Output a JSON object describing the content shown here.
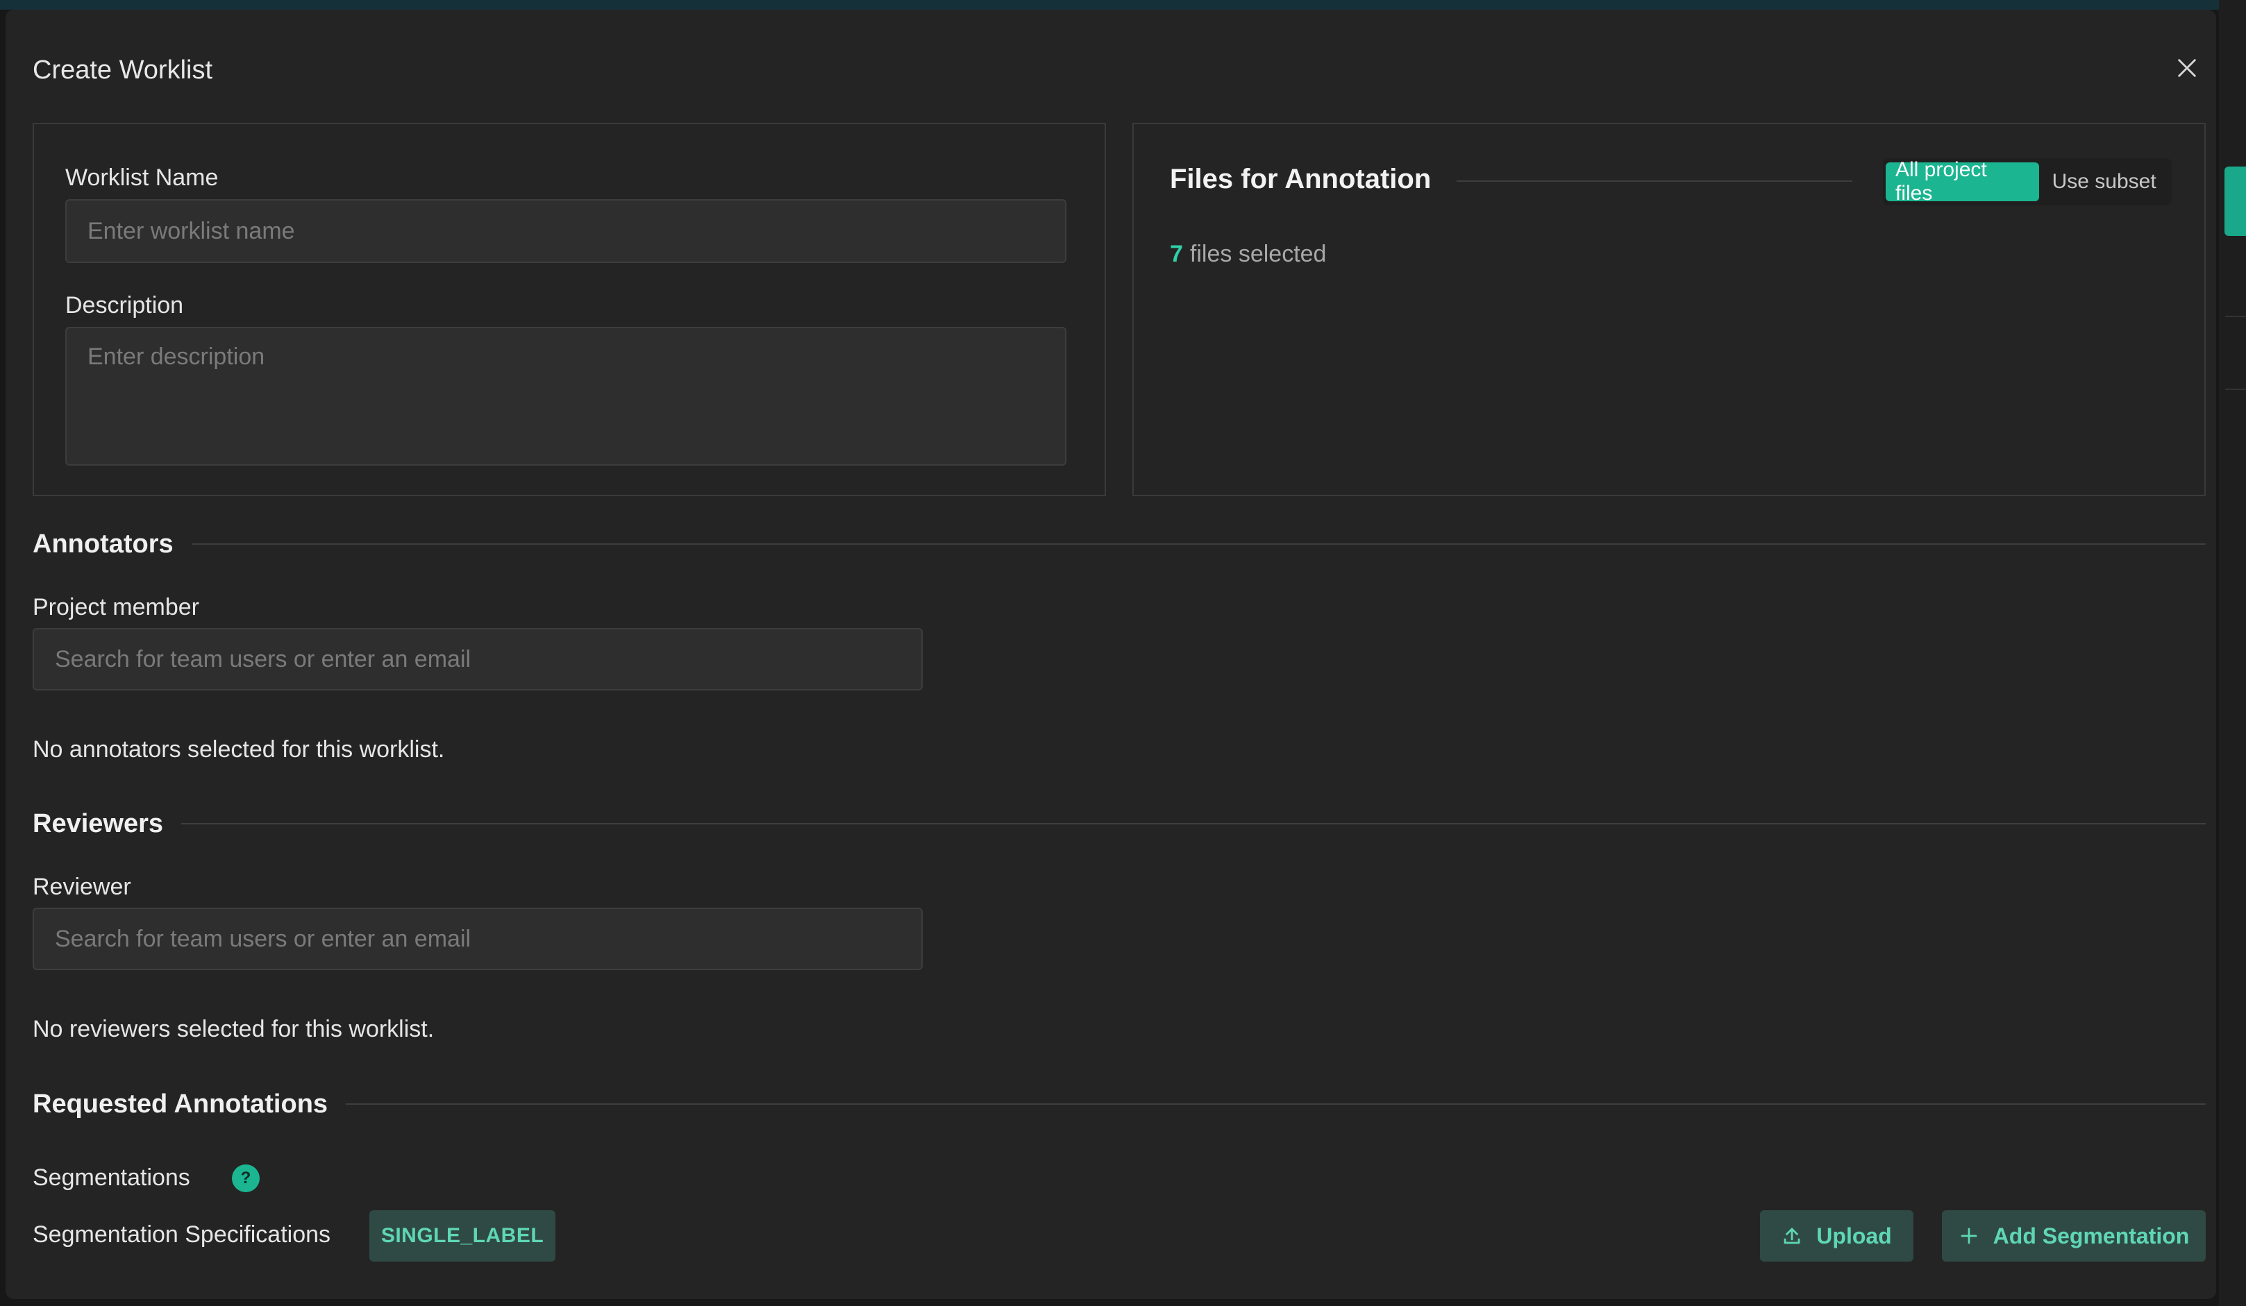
{
  "modal": {
    "title": "Create Worklist",
    "close_icon": "close-icon"
  },
  "form": {
    "name_label": "Worklist Name",
    "name_placeholder": "Enter worklist name",
    "name_value": "",
    "description_label": "Description",
    "description_placeholder": "Enter description",
    "description_value": ""
  },
  "files": {
    "title": "Files for Annotation",
    "toggle": [
      {
        "label": "All project files",
        "active": true
      },
      {
        "label": "Use subset",
        "active": false
      }
    ],
    "count": "7",
    "count_suffix": "files selected"
  },
  "annotators": {
    "title": "Annotators",
    "field_label": "Project member",
    "placeholder": "Search for team users or enter an email",
    "empty_text": "No annotators selected for this worklist."
  },
  "reviewers": {
    "title": "Reviewers",
    "field_label": "Reviewer",
    "placeholder": "Search for team users or enter an email",
    "empty_text": "No reviewers selected for this worklist."
  },
  "requested": {
    "title": "Requested Annotations",
    "segmentations_label": "Segmentations",
    "help_icon": "question-mark-icon",
    "help_glyph": "?",
    "spec_label": "Segmentation Specifications",
    "spec_chip": "SINGLE_LABEL",
    "upload_label": "Upload",
    "upload_icon": "upload-icon",
    "add_label": "Add Segmentation",
    "add_icon": "plus-icon"
  },
  "colors": {
    "accent": "#1bb591",
    "chip_bg": "#2f4a44",
    "chip_text": "#5fd7b6",
    "modal_bg": "#242424"
  }
}
